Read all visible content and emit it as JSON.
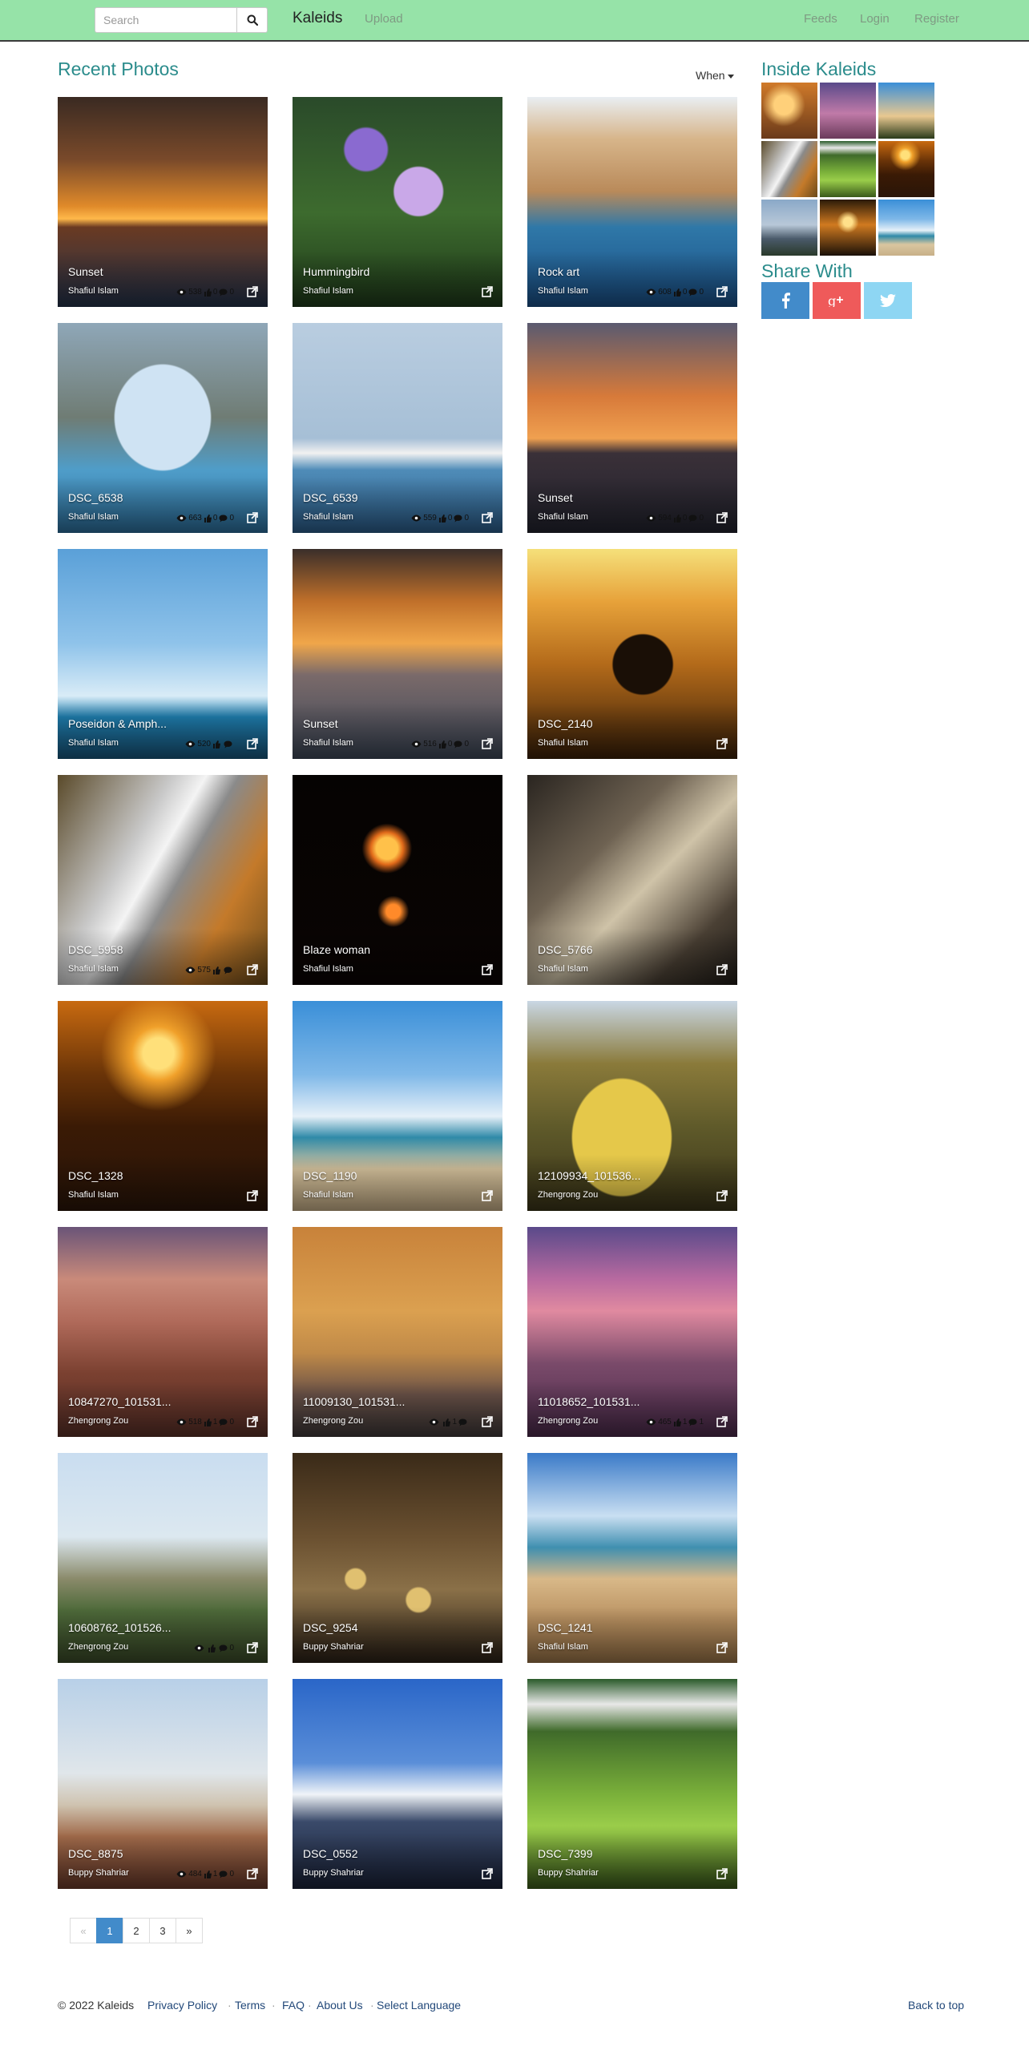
{
  "navbar": {
    "search_placeholder": "Search",
    "brand": "Kaleids",
    "upload": "Upload",
    "feeds": "Feeds",
    "login": "Login",
    "register": "Register"
  },
  "main": {
    "title": "Recent Photos",
    "sort_label": "When"
  },
  "photos": [
    {
      "title": "Sunset",
      "author": "Shafiul Islam",
      "views": "538",
      "likes": "0",
      "comments": "0",
      "icon": "sunset-pier"
    },
    {
      "title": "Hummingbird",
      "author": "Shafiul Islam",
      "views": "",
      "likes": "",
      "comments": "",
      "icon": "flowers"
    },
    {
      "title": "Rock art",
      "author": "Shafiul Islam",
      "views": "608",
      "likes": "0",
      "comments": "0",
      "icon": "rock-arch"
    },
    {
      "title": "DSC_6538",
      "author": "Shafiul Islam",
      "views": "663",
      "likes": "0",
      "comments": "0",
      "icon": "sculpture-arch"
    },
    {
      "title": "DSC_6539",
      "author": "Shafiul Islam",
      "views": "559",
      "likes": "0",
      "comments": "0",
      "icon": "tall-ship"
    },
    {
      "title": "Sunset",
      "author": "Shafiul Islam",
      "views": "594",
      "likes": "0",
      "comments": "0",
      "icon": "sunset-harbor"
    },
    {
      "title": "Poseidon & Amph...",
      "author": "Shafiul Islam",
      "views": "520",
      "likes": "",
      "comments": "",
      "icon": "poseidon-statue"
    },
    {
      "title": "Sunset",
      "author": "Shafiul Islam",
      "views": "516",
      "likes": "0",
      "comments": "0",
      "icon": "sunset-beach"
    },
    {
      "title": "DSC_2140",
      "author": "Shafiul Islam",
      "views": "",
      "likes": "",
      "comments": "",
      "icon": "cairn-silhouette"
    },
    {
      "title": "DSC_5958",
      "author": "Shafiul Islam",
      "views": "575",
      "likes": "",
      "comments": "",
      "icon": "waterfall"
    },
    {
      "title": "Blaze woman",
      "author": "Shafiul Islam",
      "views": "",
      "likes": "",
      "comments": "",
      "icon": "fire-dancer"
    },
    {
      "title": "DSC_5766",
      "author": "Shafiul Islam",
      "views": "",
      "likes": "",
      "comments": "",
      "icon": "artist-drawing"
    },
    {
      "title": "DSC_1328",
      "author": "Shafiul Islam",
      "views": "",
      "likes": "",
      "comments": "",
      "icon": "sea-sunset"
    },
    {
      "title": "DSC_1190",
      "author": "Shafiul Islam",
      "views": "",
      "likes": "",
      "comments": "",
      "icon": "beach-tree"
    },
    {
      "title": "12109934_101536...",
      "author": "Zhengrong Zou",
      "views": "",
      "likes": "",
      "comments": "",
      "icon": "yellow-bush"
    },
    {
      "title": "10847270_101531...",
      "author": "Zhengrong Zou",
      "views": "518",
      "likes": "1",
      "comments": "0",
      "icon": "coast-cliff"
    },
    {
      "title": "11009130_101531...",
      "author": "Zhengrong Zou",
      "views": "",
      "likes": "1",
      "comments": "",
      "icon": "orange-clouds"
    },
    {
      "title": "11018652_101531...",
      "author": "Zhengrong Zou",
      "views": "465",
      "likes": "1",
      "comments": "1",
      "icon": "purple-coast"
    },
    {
      "title": "10608762_101526...",
      "author": "Zhengrong Zou",
      "views": "",
      "likes": "",
      "comments": "0",
      "icon": "hills-lake"
    },
    {
      "title": "DSC_9254",
      "author": "Buppy Shahriar",
      "views": "",
      "likes": "",
      "comments": "",
      "icon": "metal-studs"
    },
    {
      "title": "DSC_1241",
      "author": "Shafiul Islam",
      "views": "",
      "likes": "",
      "comments": "",
      "icon": "driftwood-beach"
    },
    {
      "title": "DSC_8875",
      "author": "Buppy Shahriar",
      "views": "484",
      "likes": "1",
      "comments": "0",
      "icon": "clay-pots"
    },
    {
      "title": "DSC_0552",
      "author": "Buppy Shahriar",
      "views": "",
      "likes": "",
      "comments": "",
      "icon": "snow-mountains"
    },
    {
      "title": "DSC_7399",
      "author": "Buppy Shahriar",
      "views": "",
      "likes": "",
      "comments": "",
      "icon": "green-valley"
    }
  ],
  "sidebar": {
    "inside_title": "Inside Kaleids",
    "thumbs": [
      "sunset-glow",
      "purple-sky",
      "beach-palm",
      "waterfall",
      "green-valley",
      "sea-sunset",
      "mountains",
      "orange-sunset",
      "beach-tree"
    ],
    "share_title": "Share With",
    "share": [
      {
        "icon": "facebook-icon",
        "color": "#428bca"
      },
      {
        "icon": "google-plus-icon",
        "color": "#ef5a5a"
      },
      {
        "icon": "twitter-icon",
        "color": "#8ed6f3"
      }
    ]
  },
  "pagination": {
    "prev": "«",
    "pages": [
      "1",
      "2",
      "3"
    ],
    "active": "1",
    "next": "»"
  },
  "footer": {
    "copyright": "© 2022 Kaleids",
    "links": [
      "Privacy Policy",
      "Terms",
      "FAQ",
      "About Us",
      "Select Language"
    ],
    "back_to_top": "Back to top"
  },
  "colors": {
    "navbar": "#96e3a8",
    "title": "#2b8c8c",
    "link": "#23497a",
    "pagination_active": "#428bca"
  }
}
